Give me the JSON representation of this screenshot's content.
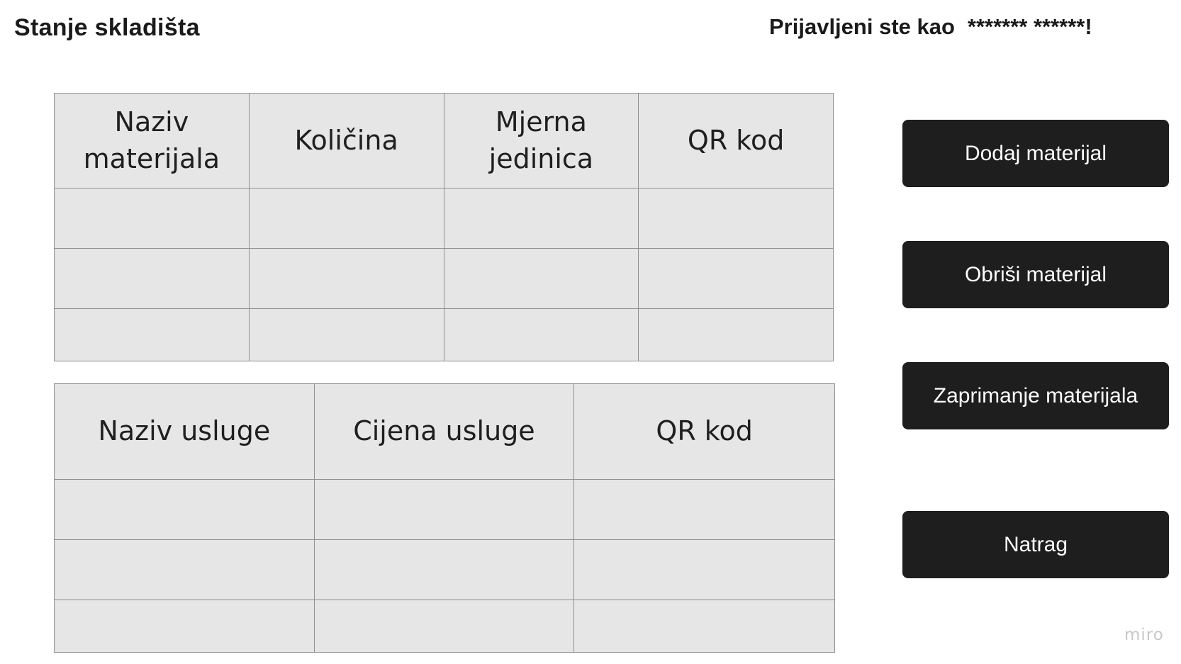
{
  "header": {
    "title": "Stanje skladišta",
    "login_prefix": "Prijavljeni ste kao",
    "user_name": "******* ******!"
  },
  "materials_table": {
    "columns": [
      "Naziv materijala",
      "Količina",
      "Mjerna jedinica",
      "QR kod"
    ],
    "rows": [
      [
        "",
        "",
        "",
        ""
      ],
      [
        "",
        "",
        "",
        ""
      ],
      [
        "",
        "",
        "",
        ""
      ]
    ]
  },
  "services_table": {
    "columns": [
      "Naziv usluge",
      "Cijena usluge",
      "QR kod"
    ],
    "rows": [
      [
        "",
        "",
        ""
      ],
      [
        "",
        "",
        ""
      ],
      [
        "",
        "",
        ""
      ]
    ]
  },
  "actions": {
    "add_material": "Dodaj materijal",
    "delete_material": "Obriši materijal",
    "receive_material": "Zaprimanje materijala",
    "back": "Natrag"
  },
  "watermark": "miro",
  "colors": {
    "button_bg": "#1e1e1e",
    "button_text": "#ffffff",
    "table_bg": "#e6e6e6",
    "table_border": "#8f8f8f"
  }
}
